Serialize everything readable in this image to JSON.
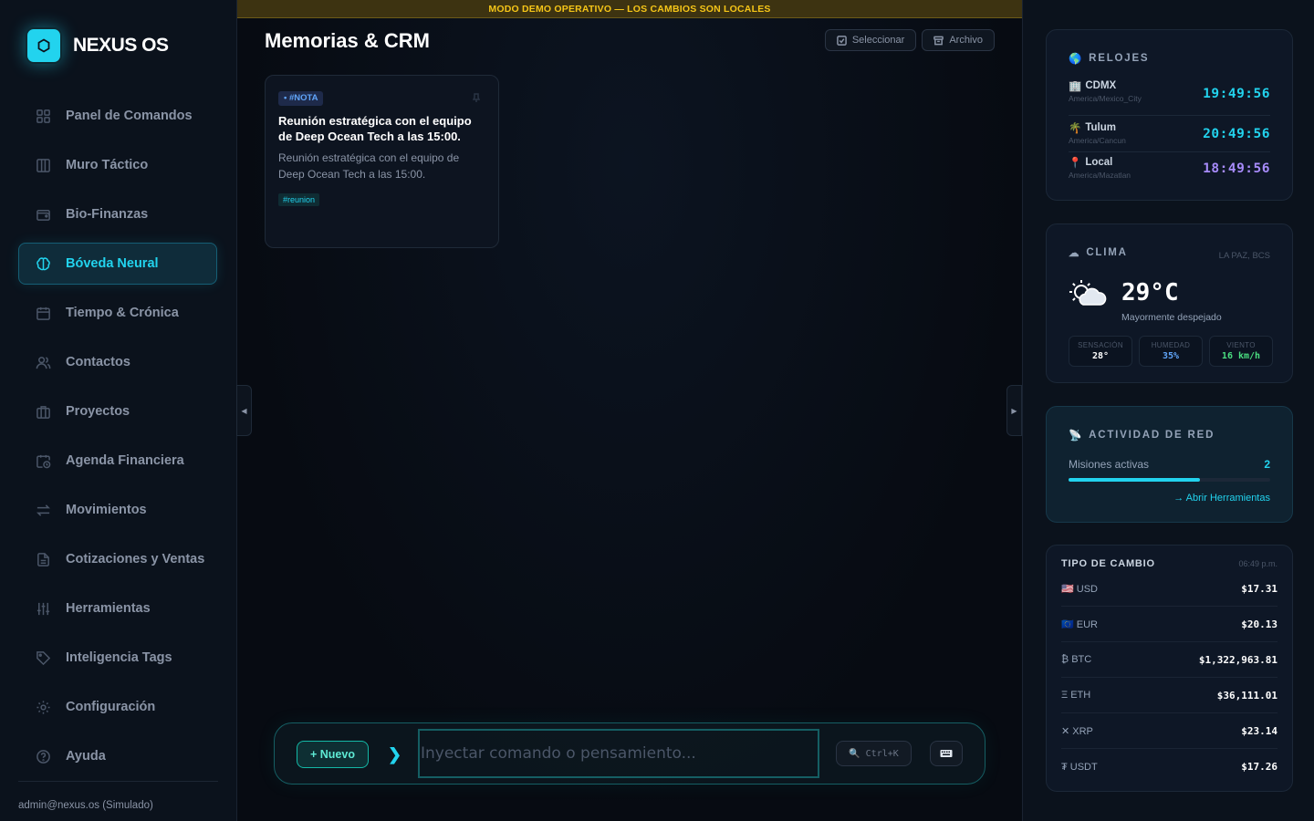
{
  "brand": {
    "name": "NEXUS OS"
  },
  "sidebar": {
    "items": [
      {
        "label": "Panel de Comandos",
        "icon": "grid-icon"
      },
      {
        "label": "Muro Táctico",
        "icon": "columns-icon"
      },
      {
        "label": "Bio-Finanzas",
        "icon": "wallet-icon"
      },
      {
        "label": "Bóveda Neural",
        "icon": "brain-icon",
        "active": true
      },
      {
        "label": "Tiempo & Crónica",
        "icon": "calendar-icon"
      },
      {
        "label": "Contactos",
        "icon": "users-icon"
      },
      {
        "label": "Proyectos",
        "icon": "briefcase-icon"
      },
      {
        "label": "Agenda Financiera",
        "icon": "calendar-clock-icon"
      },
      {
        "label": "Movimientos",
        "icon": "arrows-icon"
      },
      {
        "label": "Cotizaciones y Ventas",
        "icon": "file-icon"
      },
      {
        "label": "Herramientas",
        "icon": "sliders-icon"
      },
      {
        "label": "Inteligencia Tags",
        "icon": "tag-icon"
      },
      {
        "label": "Configuración",
        "icon": "gear-icon"
      },
      {
        "label": "Ayuda",
        "icon": "help-icon"
      }
    ],
    "user": "admin@nexus.os (Simulado)"
  },
  "banner": "MODO DEMO OPERATIVO — LOS CAMBIOS SON LOCALES",
  "main": {
    "title": "Memorias & CRM",
    "actions": {
      "select": "Seleccionar",
      "archive": "Archivo"
    },
    "note": {
      "type": "• #NOTA",
      "title": "Reunión estratégica con el equipo de Deep Ocean Tech a las 15:00.",
      "body": "Reunión estratégica con el equipo de Deep Ocean Tech a las 15:00.",
      "tag": "#reunion"
    },
    "command": {
      "new_label": "+ Nuevo",
      "prompt": "❯",
      "placeholder": "Inyectar comando o pensamiento...",
      "search_shortcut": "Ctrl+K"
    }
  },
  "clocks": {
    "title": "RELOJES",
    "items": [
      {
        "city": "CDMX",
        "tz": "America/Mexico_City",
        "time": "19:49:56",
        "icon": "building-icon"
      },
      {
        "city": "Tulum",
        "tz": "America/Cancun",
        "time": "20:49:56",
        "icon": "palm-icon"
      },
      {
        "city": "Local",
        "tz": "America/Mazatlan",
        "time": "18:49:56",
        "icon": "pin-icon"
      }
    ]
  },
  "weather": {
    "title": "CLIMA",
    "location": "LA PAZ, BCS",
    "temp": "29°C",
    "desc": "Mayormente despejado",
    "metrics": [
      {
        "label": "SENSACIÓN",
        "value": "28°",
        "color": "#ffffff"
      },
      {
        "label": "HUMEDAD",
        "value": "35%",
        "color": "#60a5fa"
      },
      {
        "label": "VIENTO",
        "value": "16 km/h",
        "color": "#4ade80"
      }
    ]
  },
  "network": {
    "title": "ACTIVIDAD DE RED",
    "label": "Misiones activas",
    "count": "2",
    "progress": 0.65,
    "link": "→ Abrir Herramientas"
  },
  "fx": {
    "title": "TIPO DE CAMBIO",
    "time": "06:49 p.m.",
    "rows": [
      {
        "name": "🇺🇸 USD",
        "value": "$17.31"
      },
      {
        "name": "🇪🇺 EUR",
        "value": "$20.13"
      },
      {
        "name": "₿ BTC",
        "value": "$1,322,963.81"
      },
      {
        "name": "Ξ ETH",
        "value": "$36,111.01"
      },
      {
        "name": "✕ XRP",
        "value": "$23.14"
      },
      {
        "name": "₮ USDT",
        "value": "$17.26"
      }
    ]
  },
  "colors": {
    "accent": "#22d3ee",
    "banner": "#f5c518",
    "purple": "#a78bfa"
  }
}
